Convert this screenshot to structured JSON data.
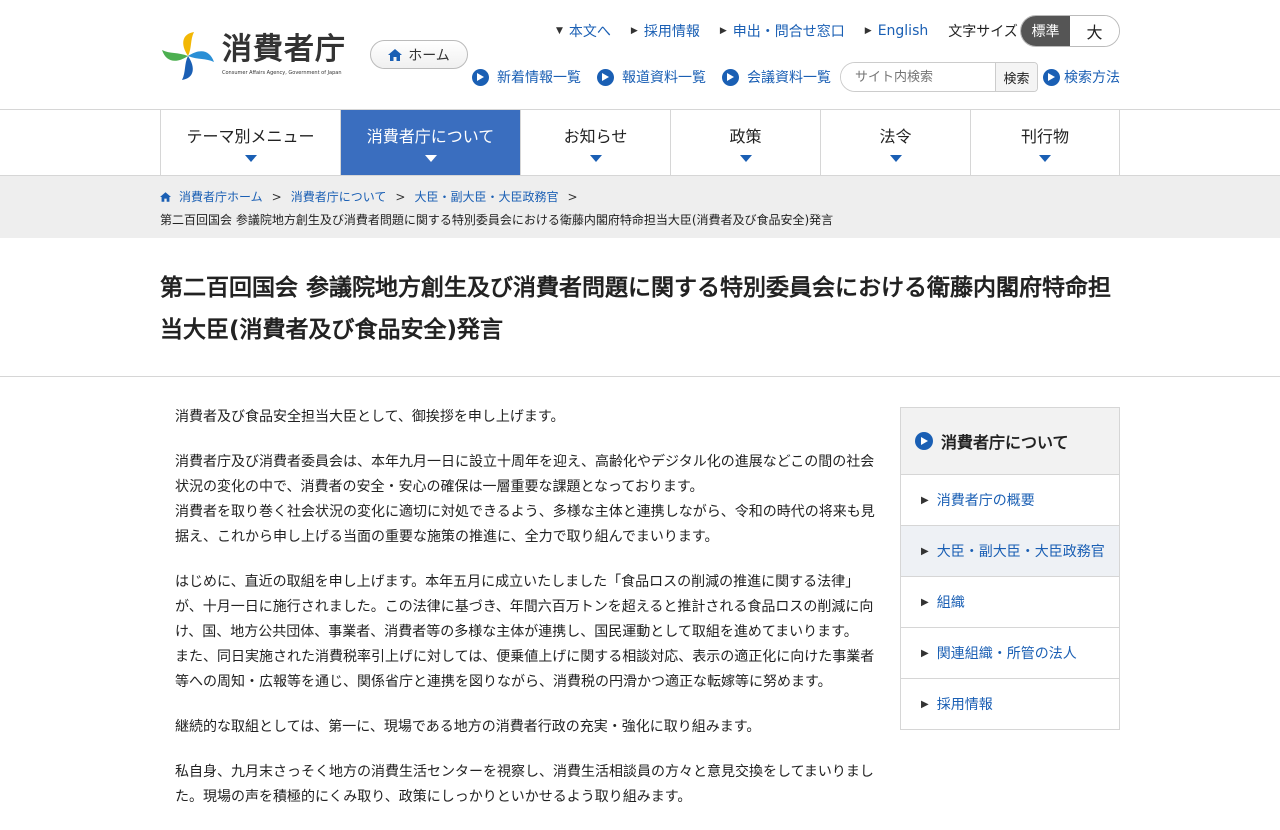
{
  "header": {
    "logo_text": "消費者庁",
    "logo_sub": "Consumer Affairs Agency, Government of Japan",
    "home_label": "ホーム",
    "util_links": [
      "本文へ",
      "採用情報",
      "申出・問合せ窓口",
      "English"
    ],
    "font_size_label": "文字サイズ",
    "font_size_options": [
      "標準",
      "大"
    ],
    "quick_links": [
      "新着情報一覧",
      "報道資料一覧",
      "会議資料一覧"
    ],
    "search_placeholder": "サイト内検索",
    "search_button": "検索",
    "search_howto": "検索方法"
  },
  "gnav": {
    "items": [
      "テーマ別メニュー",
      "消費者庁について",
      "お知らせ",
      "政策",
      "法令",
      "刊行物"
    ],
    "active_index": 1
  },
  "breadcrumb": {
    "items": [
      "消費者庁ホーム",
      "消費者庁について",
      "大臣・副大臣・大臣政務官"
    ],
    "current": "第二百回国会 参議院地方創生及び消費者問題に関する特別委員会における衛藤内閣府特命担当大臣(消費者及び食品安全)発言"
  },
  "page": {
    "title": "第二百回国会 参議院地方創生及び消費者問題に関する特別委員会における衛藤内閣府特命担当大臣(消費者及び食品安全)発言",
    "paragraphs": [
      "消費者及び食品安全担当大臣として、御挨拶を申し上げます。",
      "消費者庁及び消費者委員会は、本年九月一日に設立十周年を迎え、高齢化やデジタル化の進展などこの間の社会状況の変化の中で、消費者の安全・安心の確保は一層重要な課題となっております。\n消費者を取り巻く社会状況の変化に適切に対処できるよう、多様な主体と連携しながら、令和の時代の将来も見据え、これから申し上げる当面の重要な施策の推進に、全力で取り組んでまいります。",
      "はじめに、直近の取組を申し上げます。本年五月に成立いたしました「食品ロスの削減の推進に関する法律」が、十月一日に施行されました。この法律に基づき、年間六百万トンを超えると推計される食品ロスの削減に向け、国、地方公共団体、事業者、消費者等の多様な主体が連携し、国民運動として取組を進めてまいります。\nまた、同日実施された消費税率引上げに対しては、便乗値上げに関する相談対応、表示の適正化に向けた事業者等への周知・広報等を通じ、関係省庁と連携を図りながら、消費税の円滑かつ適正な転嫁等に努めます。",
      "継続的な取組としては、第一に、現場である地方の消費者行政の充実・強化に取り組みます。",
      "私自身、九月末さっそく地方の消費生活センターを視察し、消費生活相談員の方々と意見交換をしてまいりました。現場の声を積極的にくみ取り、政策にしっかりといかせるよう取り組みます。"
    ]
  },
  "sidebar": {
    "heading": "消費者庁について",
    "items": [
      "消費者庁の概要",
      "大臣・副大臣・大臣政務官",
      "組織",
      "関連組織・所管の法人",
      "採用情報"
    ],
    "current_index": 1
  },
  "colors": {
    "link": "#1a5fb4",
    "nav_active": "#3a6ebf"
  }
}
